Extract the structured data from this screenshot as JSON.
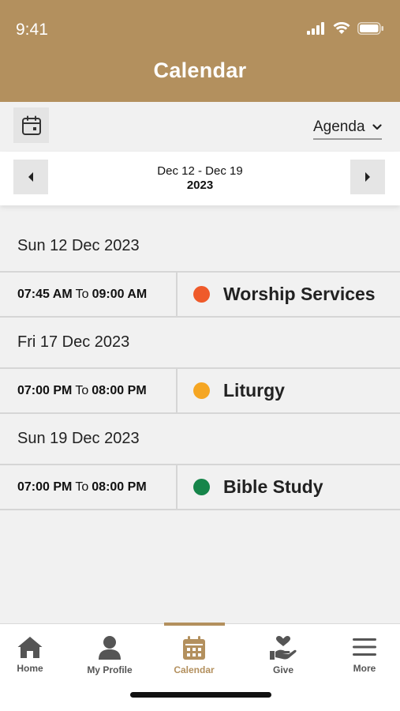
{
  "status": {
    "time": "9:41"
  },
  "header": {
    "title": "Calendar"
  },
  "toolbar": {
    "view": "Agenda"
  },
  "range": {
    "dates": "Dec 12 - Dec 19",
    "year": "2023"
  },
  "days": [
    {
      "date": "Sun 12 Dec 2023",
      "event": {
        "start": "07:45 AM",
        "to": "To",
        "end": "09:00 AM",
        "name": "Worship Services",
        "color": "#ef5a2a"
      }
    },
    {
      "date": "Fri 17 Dec 2023",
      "event": {
        "start": "07:00 PM",
        "to": "To",
        "end": "08:00 PM",
        "name": "Liturgy",
        "color": "#f5a623"
      }
    },
    {
      "date": "Sun 19 Dec 2023",
      "event": {
        "start": "07:00 PM",
        "to": "To",
        "end": "08:00 PM",
        "name": "Bible Study",
        "color": "#16854a"
      }
    }
  ],
  "tabs": [
    {
      "label": "Home",
      "icon": "home-icon"
    },
    {
      "label": "My Profile",
      "icon": "user-icon"
    },
    {
      "label": "Calendar",
      "icon": "calendar-icon",
      "active": true
    },
    {
      "label": "Give",
      "icon": "give-icon"
    },
    {
      "label": "More",
      "icon": "menu-icon"
    }
  ],
  "colors": {
    "brand": "#b3905e"
  }
}
